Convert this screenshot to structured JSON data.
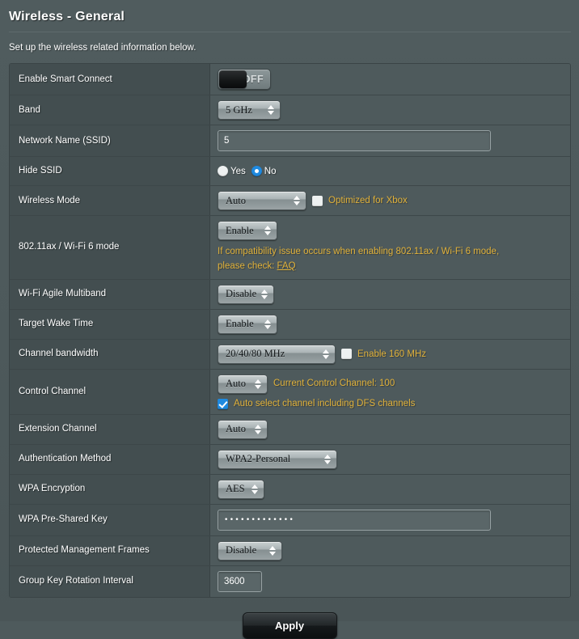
{
  "header": {
    "title": "Wireless - General",
    "subtitle": "Set up the wireless related information below."
  },
  "rows": {
    "smart_connect": {
      "label": "Enable Smart Connect",
      "toggle_state": "OFF"
    },
    "band": {
      "label": "Band",
      "value": "5 GHz"
    },
    "ssid": {
      "label": "Network Name (SSID)",
      "value": "5"
    },
    "hide_ssid": {
      "label": "Hide SSID",
      "yes_label": "Yes",
      "no_label": "No",
      "selected": "No"
    },
    "wireless_mode": {
      "label": "Wireless Mode",
      "value": "Auto",
      "xbox_label": "Optimized for Xbox",
      "xbox_checked": false
    },
    "ax_mode": {
      "label": "802.11ax / Wi-Fi 6 mode",
      "value": "Enable",
      "hint_line1": "If compatibility issue occurs when enabling 802.11ax / Wi-Fi 6 mode,",
      "hint_line2": "please check:",
      "faq_label": "FAQ"
    },
    "agile_multiband": {
      "label": "Wi-Fi Agile Multiband",
      "value": "Disable"
    },
    "target_wake_time": {
      "label": "Target Wake Time",
      "value": "Enable"
    },
    "channel_bandwidth": {
      "label": "Channel bandwidth",
      "value": "20/40/80 MHz",
      "enable160_label": "Enable 160 MHz",
      "enable160_checked": false
    },
    "control_channel": {
      "label": "Control Channel",
      "value": "Auto",
      "current_text": "Current Control Channel: 100",
      "dfs_label": "Auto select channel including DFS channels",
      "dfs_checked": true
    },
    "extension_channel": {
      "label": "Extension Channel",
      "value": "Auto"
    },
    "auth_method": {
      "label": "Authentication Method",
      "value": "WPA2-Personal"
    },
    "wpa_encryption": {
      "label": "WPA Encryption",
      "value": "AES"
    },
    "psk": {
      "label": "WPA Pre-Shared Key",
      "value": "•••••••••••••"
    },
    "pmf": {
      "label": "Protected Management Frames",
      "value": "Disable"
    },
    "group_key": {
      "label": "Group Key Rotation Interval",
      "value": "3600"
    }
  },
  "footer": {
    "apply_label": "Apply"
  },
  "colors": {
    "page_bg": "#4e5a5c",
    "label_bg": "#434e50",
    "accent_orange": "#e0b13a",
    "accent_blue": "#1f8ae0"
  }
}
